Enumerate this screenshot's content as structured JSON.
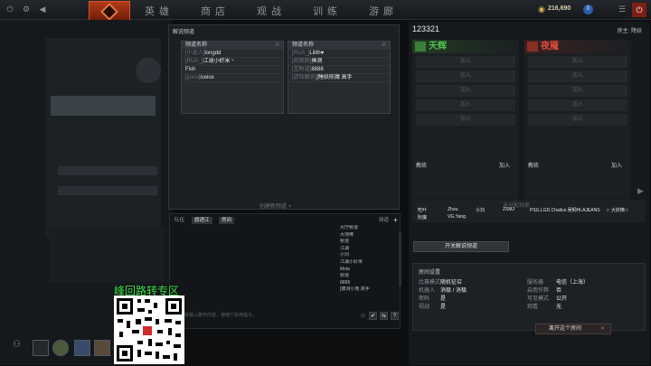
{
  "topbar": {
    "nav": [
      "英雄",
      "商店",
      "观战",
      "训练",
      "游廊"
    ],
    "currency": "216,690",
    "level_badge": "0",
    "power_icon": "power-icon",
    "settings_icon": "gear-icon",
    "close_icon": "close-icon"
  },
  "channels": {
    "title": "解说频道",
    "columns": [
      {
        "header": "频道名称",
        "rows": [
          {
            "tag": "[小龙人]",
            "name": "longdd"
          },
          {
            "tag": "[RUA_]",
            "name": "江湖小虾米丶"
          },
          {
            "tag": "",
            "name": "Fish"
          },
          {
            "tag": "[yoou]",
            "name": "iceice"
          }
        ]
      },
      {
        "header": "频道名称",
        "rows": [
          {
            "tag": "[RUA_]",
            "name": "Lilith♥"
          },
          {
            "tag": "[奇数跳]",
            "name": "揍测"
          },
          {
            "tag": "[互粉道]",
            "name": "8888"
          },
          {
            "tag": "[游戏解说]",
            "name": "[睡妖陈魔 高手"
          }
        ]
      }
    ],
    "create_label": "创建新频道 +"
  },
  "chat": {
    "tabs": [
      "队伍",
      "旗语江",
      "房间"
    ],
    "tab_right": "频道",
    "list": [
      "大厅频道",
      "大地棒",
      "频道",
      "江湖",
      "小刘",
      "江湖小虾米",
      "Mola",
      "频道",
      "8888",
      "[揍测小熊 高手"
    ],
    "input_placeholder": "在此处输入聊天内容，使用\"/\"启用指令。",
    "buttons": [
      "✔",
      "⇆",
      "?"
    ]
  },
  "lobby": {
    "id": "123321",
    "host": "房主: 降妖",
    "radiant": {
      "name": "天辉",
      "color": "#4ec34b",
      "slots": [
        "加入",
        "加入",
        "加入",
        "加入",
        "加入"
      ]
    },
    "dire": {
      "name": "夜魇",
      "color": "#e04a3a",
      "slots": [
        "加入",
        "加入",
        "加入",
        "加入",
        "加入"
      ]
    },
    "coach_label": "教练",
    "join_label": "加入",
    "unassigned_title": "未分配玩家",
    "unassigned": [
      "吃叶",
      "Zhou",
      "小刘",
      "ZSMJ",
      "PSG.LGD.Chalice.吴桐HLAJEANS",
      "☆ 大妖精☆",
      "阮魔",
      "VG.Yang"
    ],
    "broadcast_btn": "开关解说频道",
    "settings_title": "房间设置",
    "settings": [
      {
        "label": "比赛模式",
        "value": "随机征召"
      },
      {
        "label": "服务器",
        "value": "电信（上海）"
      },
      {
        "label": "机器人",
        "value": "消极 / 消极"
      },
      {
        "label": "启用作弊",
        "value": "否"
      },
      {
        "label": "密码",
        "value": "是"
      },
      {
        "label": "可见模式",
        "value": "公开"
      },
      {
        "label": "视战",
        "value": "是"
      },
      {
        "label": "观看",
        "value": "无"
      }
    ],
    "leave_btn": "离开这个房间"
  },
  "overlay": {
    "qr_title": "峰回路转专区"
  },
  "colors": {
    "accent": "#b43a16",
    "bg": "#0c0e10"
  }
}
